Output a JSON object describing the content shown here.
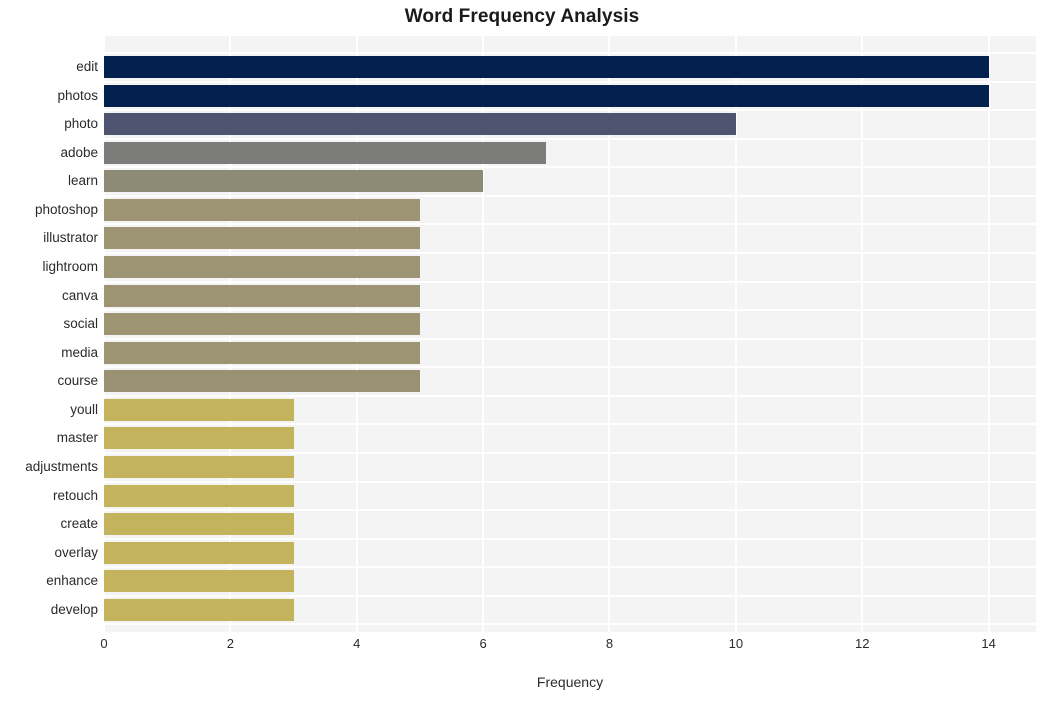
{
  "chart_data": {
    "type": "bar",
    "orientation": "horizontal",
    "title": "Word Frequency Analysis",
    "xlabel": "Frequency",
    "ylabel": "",
    "xlim": [
      0,
      14.75
    ],
    "xticks": [
      0,
      2,
      4,
      6,
      8,
      10,
      12,
      14
    ],
    "xtick_labels": [
      "0",
      "2",
      "4",
      "6",
      "8",
      "10",
      "12",
      "14"
    ],
    "grid": true,
    "legend": null,
    "categories": [
      "edit",
      "photos",
      "photo",
      "adobe",
      "learn",
      "photoshop",
      "illustrator",
      "lightroom",
      "canva",
      "social",
      "media",
      "course",
      "youll",
      "master",
      "adjustments",
      "retouch",
      "create",
      "overlay",
      "enhance",
      "develop"
    ],
    "values": [
      14,
      14,
      10,
      7,
      6,
      5,
      5,
      5,
      5,
      5,
      5,
      5,
      3,
      3,
      3,
      3,
      3,
      3,
      3,
      3
    ],
    "bar_colors": [
      "#03204f",
      "#03204f",
      "#4f5570",
      "#7c7c7b",
      "#8d8a76",
      "#9d9473",
      "#9d9473",
      "#9d9473",
      "#9d9473",
      "#9d9473",
      "#9d9473",
      "#9a9173",
      "#c3b35c",
      "#c3b35c",
      "#c3b35c",
      "#c3b35c",
      "#c3b35c",
      "#c3b35c",
      "#c3b35c",
      "#c3b35c"
    ]
  },
  "style": {
    "plot_background": "#f4f4f4",
    "page_background": "#ffffff",
    "gridline_color": "#ffffff",
    "text_color": "#2b2b2b",
    "title_color": "#1a1a1a"
  }
}
